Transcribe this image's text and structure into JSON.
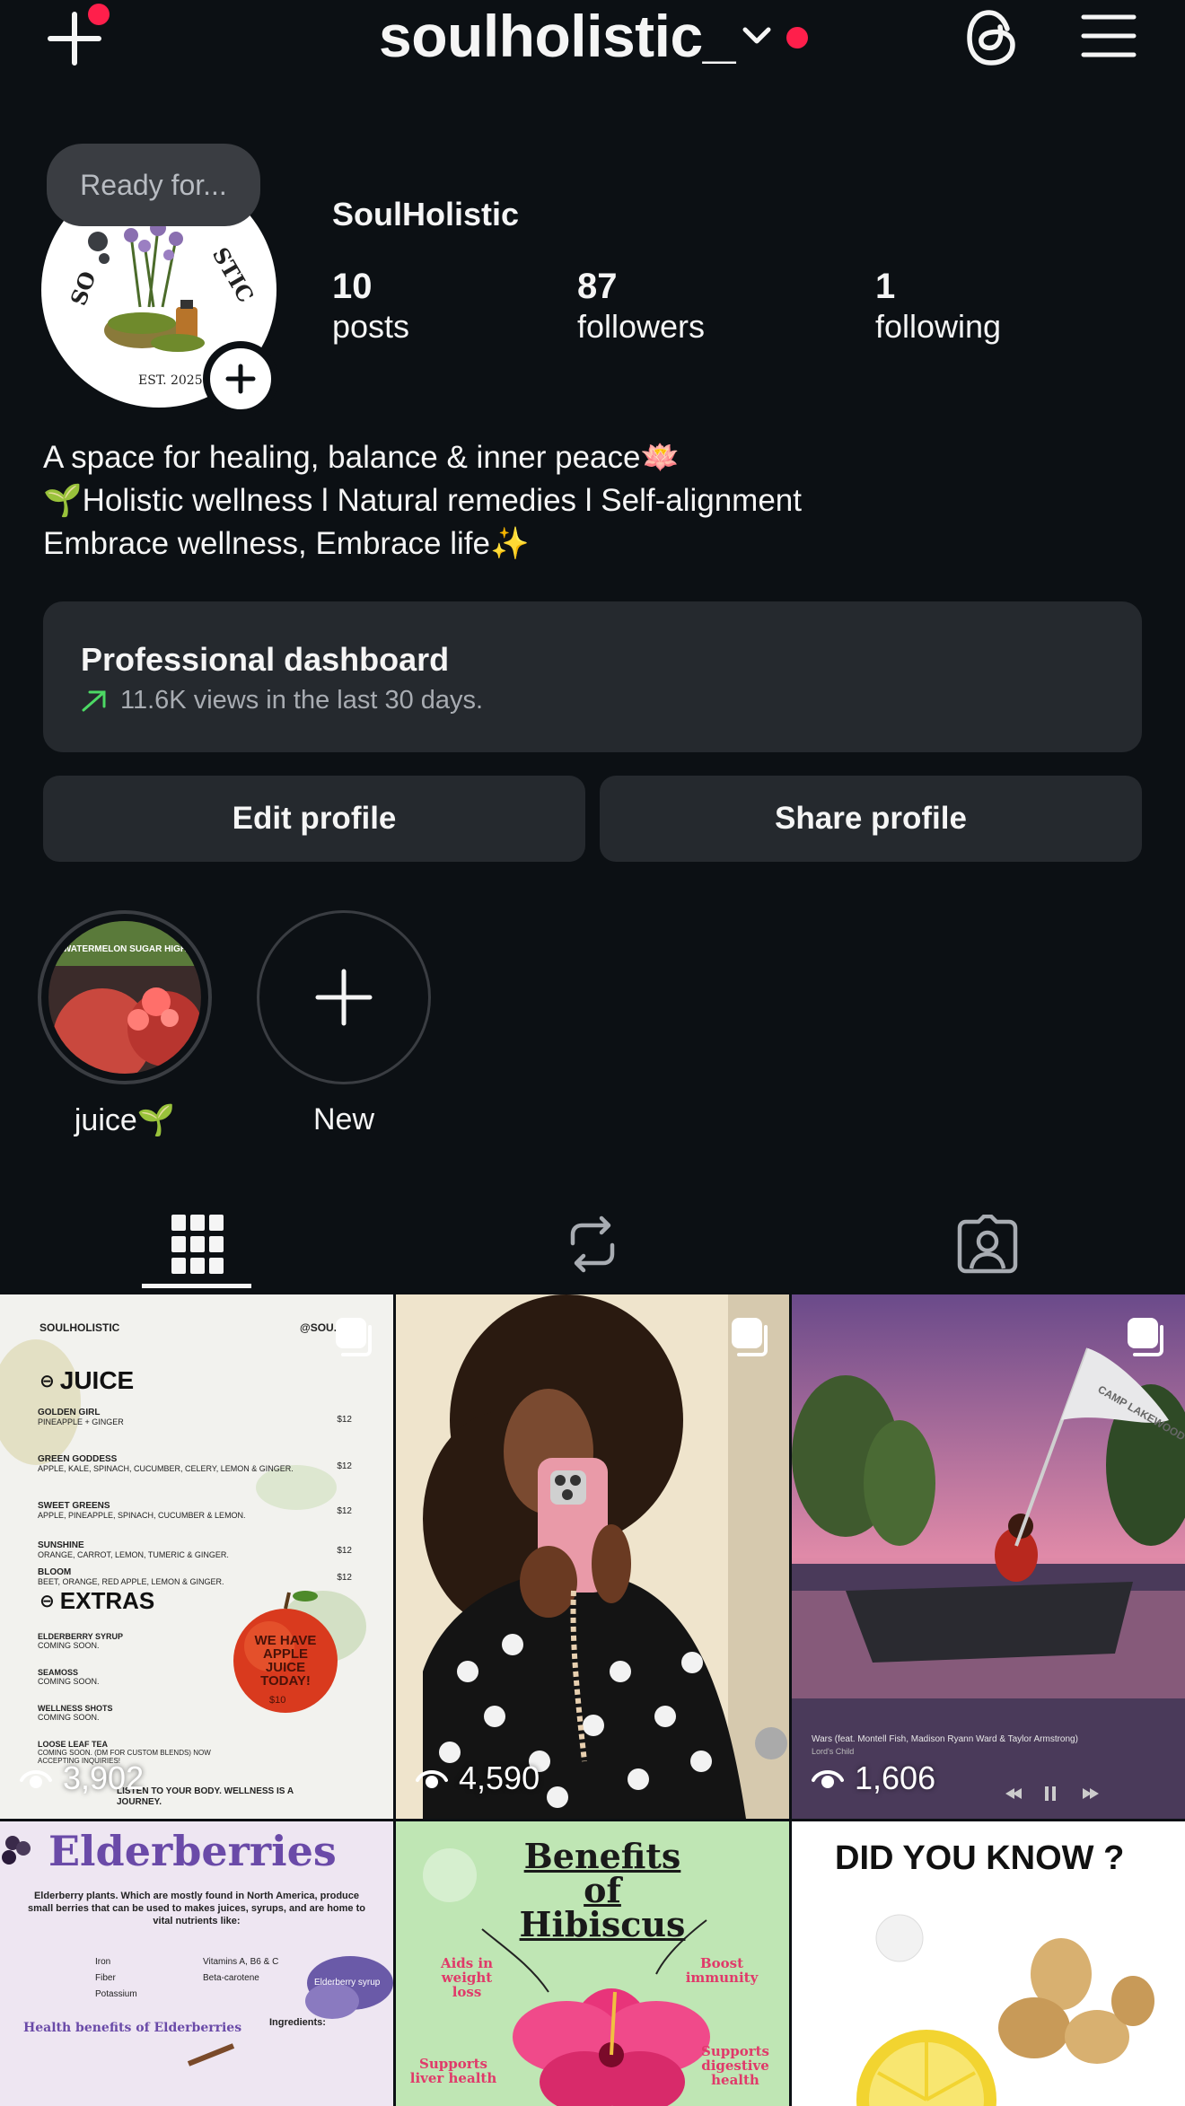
{
  "header": {
    "username": "soulholistic_",
    "icons": [
      "plus-icon",
      "chevron-down-icon",
      "threads-icon",
      "menu-icon"
    ],
    "notification_color": "#ff1f4b"
  },
  "profile": {
    "note": "Ready for...",
    "display_name": "SoulHolistic",
    "stats": [
      {
        "num": "10",
        "label": "posts"
      },
      {
        "num": "87",
        "label": "followers"
      },
      {
        "num": "1",
        "label": "following"
      }
    ],
    "bio": [
      "A space for healing, balance & inner peace🪷",
      "🌱Holistic wellness l Natural remedies l Self-alignment",
      "Embrace wellness, Embrace life✨"
    ]
  },
  "dashboard": {
    "title": "Professional dashboard",
    "subtitle": "11.6K views in the last 30 days.",
    "accent": "#4cd964"
  },
  "buttons": {
    "edit": "Edit profile",
    "share": "Share profile"
  },
  "highlights": [
    {
      "label": "juice🌱",
      "cover_text": "WATERMELON SUGAR HIGH"
    },
    {
      "label": "New"
    }
  ],
  "tabs": [
    "grid-icon",
    "reposts-icon",
    "tagged-icon"
  ],
  "grid": {
    "posts": [
      {
        "views": "3,902",
        "brand": "SOULHOLISTIC",
        "handle": "@SOU...",
        "juice_heading": "JUICE",
        "juices": [
          {
            "name": "GOLDEN GIRL",
            "desc": "PINEAPPLE + GINGER",
            "price": "$12"
          },
          {
            "name": "GREEN GODDESS",
            "desc": "APPLE, KALE, SPINACH, CUCUMBER, CELERY, LEMON & GINGER.",
            "price": "$12"
          },
          {
            "name": "SWEET GREENS",
            "desc": "APPLE, PINEAPPLE, SPINACH, CUCUMBER & LEMON.",
            "price": "$12"
          },
          {
            "name": "SUNSHINE",
            "desc": "ORANGE, CARROT, LEMON, TUMERIC & GINGER.",
            "price": "$12"
          },
          {
            "name": "BLOOM",
            "desc": "BEET, ORANGE, RED APPLE, LEMON & GINGER.",
            "price": "$12"
          }
        ],
        "extras_heading": "EXTRAS",
        "extras": [
          {
            "name": "ELDERBERRY SYRUP",
            "desc": "COMING SOON."
          },
          {
            "name": "SEAMOSS",
            "desc": "COMING SOON."
          },
          {
            "name": "WELLNESS SHOTS",
            "desc": "COMING SOON."
          },
          {
            "name": "LOOSE LEAF TEA",
            "desc": "COMING SOON. (DM FOR CUSTOM BLENDS) NOW ACCEPTING INQUIRIES!"
          }
        ],
        "apple_text": "WE HAVE APPLE JUICE TODAY!",
        "apple_price": "$10",
        "footer": "LISTEN TO YOUR BODY. WELLNESS IS A JOURNEY."
      },
      {
        "views": "4,590"
      },
      {
        "views": "1,606",
        "caption": "Wars (feat. Montell Fish, Madison Ryann Ward & Taylor Armstrong)",
        "subcaption": "Lord's Child",
        "flag_text": "CAMP LAKEWOOD"
      },
      {
        "title": "Elderberries",
        "intro": "Elderberry plants. Which are mostly found in North America, produce small berries that can be used to makes juices, syrups, and are home to vital nutrients like:",
        "nutrients_left": [
          "Iron",
          "Fiber",
          "Potassium"
        ],
        "nutrients_right": [
          "Vitamins A, B6 & C",
          "Beta-carotene"
        ],
        "benefits_heading": "Health benefits of Elderberries",
        "ingredients_heading": "Ingredients:",
        "syrup_label": "Elderberry syrup"
      },
      {
        "title": "Benefits of Hibiscus",
        "labels": [
          "Aids in weight loss",
          "Boost immunity",
          "Supports liver health",
          "Supports digestive health"
        ]
      },
      {
        "title": "DID YOU KNOW ?"
      }
    ]
  }
}
